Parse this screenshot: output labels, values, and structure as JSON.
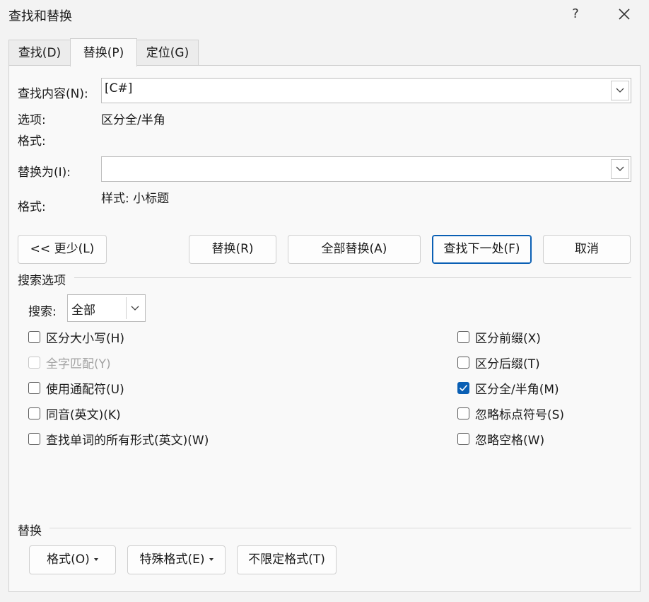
{
  "window": {
    "title": "查找和替换",
    "help": "?"
  },
  "tabs": [
    {
      "label": "查找(D)"
    },
    {
      "label": "替换(P)"
    },
    {
      "label": "定位(G)"
    }
  ],
  "find": {
    "label": "查找内容(N):",
    "value": "[C#]",
    "options_label": "选项:",
    "options_value": "区分全/半角",
    "format_label": "格式:",
    "format_value": ""
  },
  "replace": {
    "label": "替换为(I):",
    "value": "",
    "format_label": "格式:",
    "format_value": "样式: 小标题"
  },
  "buttons": {
    "less": "<< 更少(L)",
    "replace": "替换(R)",
    "replace_all": "全部替换(A)",
    "find_next": "查找下一处(F)",
    "cancel": "取消"
  },
  "search_options": {
    "title": "搜索选项",
    "search_label": "搜索:",
    "search_value": "全部",
    "left": [
      {
        "label": "区分大小写(H)",
        "checked": false,
        "disabled": false
      },
      {
        "label": "全字匹配(Y)",
        "checked": false,
        "disabled": true
      },
      {
        "label": "使用通配符(U)",
        "checked": false,
        "disabled": false
      },
      {
        "label": "同音(英文)(K)",
        "checked": false,
        "disabled": false
      },
      {
        "label": "查找单词的所有形式(英文)(W)",
        "checked": false,
        "disabled": false
      }
    ],
    "right": [
      {
        "label": "区分前缀(X)",
        "checked": false,
        "disabled": false
      },
      {
        "label": "区分后缀(T)",
        "checked": false,
        "disabled": false
      },
      {
        "label": "区分全/半角(M)",
        "checked": true,
        "disabled": false
      },
      {
        "label": "忽略标点符号(S)",
        "checked": false,
        "disabled": false
      },
      {
        "label": "忽略空格(W)",
        "checked": false,
        "disabled": false
      }
    ]
  },
  "replace_section": {
    "title": "替换",
    "format_btn": "格式(O)",
    "special_btn": "特殊格式(E)",
    "no_format_btn": "不限定格式(T)"
  },
  "colors": {
    "accent": "#0a5fb4",
    "background": "#f3f3f3",
    "panel": "#f9f9f9"
  }
}
